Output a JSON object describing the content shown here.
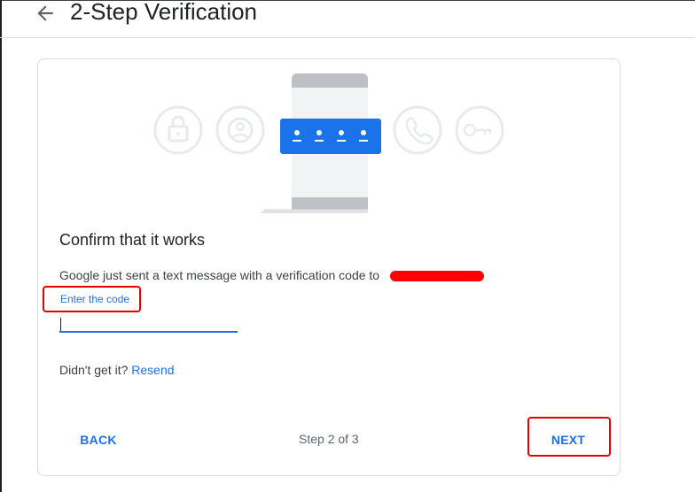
{
  "header": {
    "title": "2-Step Verification"
  },
  "card": {
    "heading": "Confirm that it works",
    "message": "Google just sent a text message with a verification code to",
    "code_label": "Enter the code",
    "code_value": "",
    "resend_prompt": "Didn't get it?",
    "resend_link": "Resend",
    "back_label": "BACK",
    "step_text": "Step 2 of 3",
    "next_label": "NEXT"
  },
  "icons": [
    "back-arrow-icon",
    "lock-icon",
    "account-icon",
    "phone-code-icon",
    "phone-call-icon",
    "key-icon"
  ],
  "colors": {
    "accent": "#1a73e8",
    "highlight": "#e30000",
    "text": "#202124",
    "muted": "#5f6368"
  }
}
